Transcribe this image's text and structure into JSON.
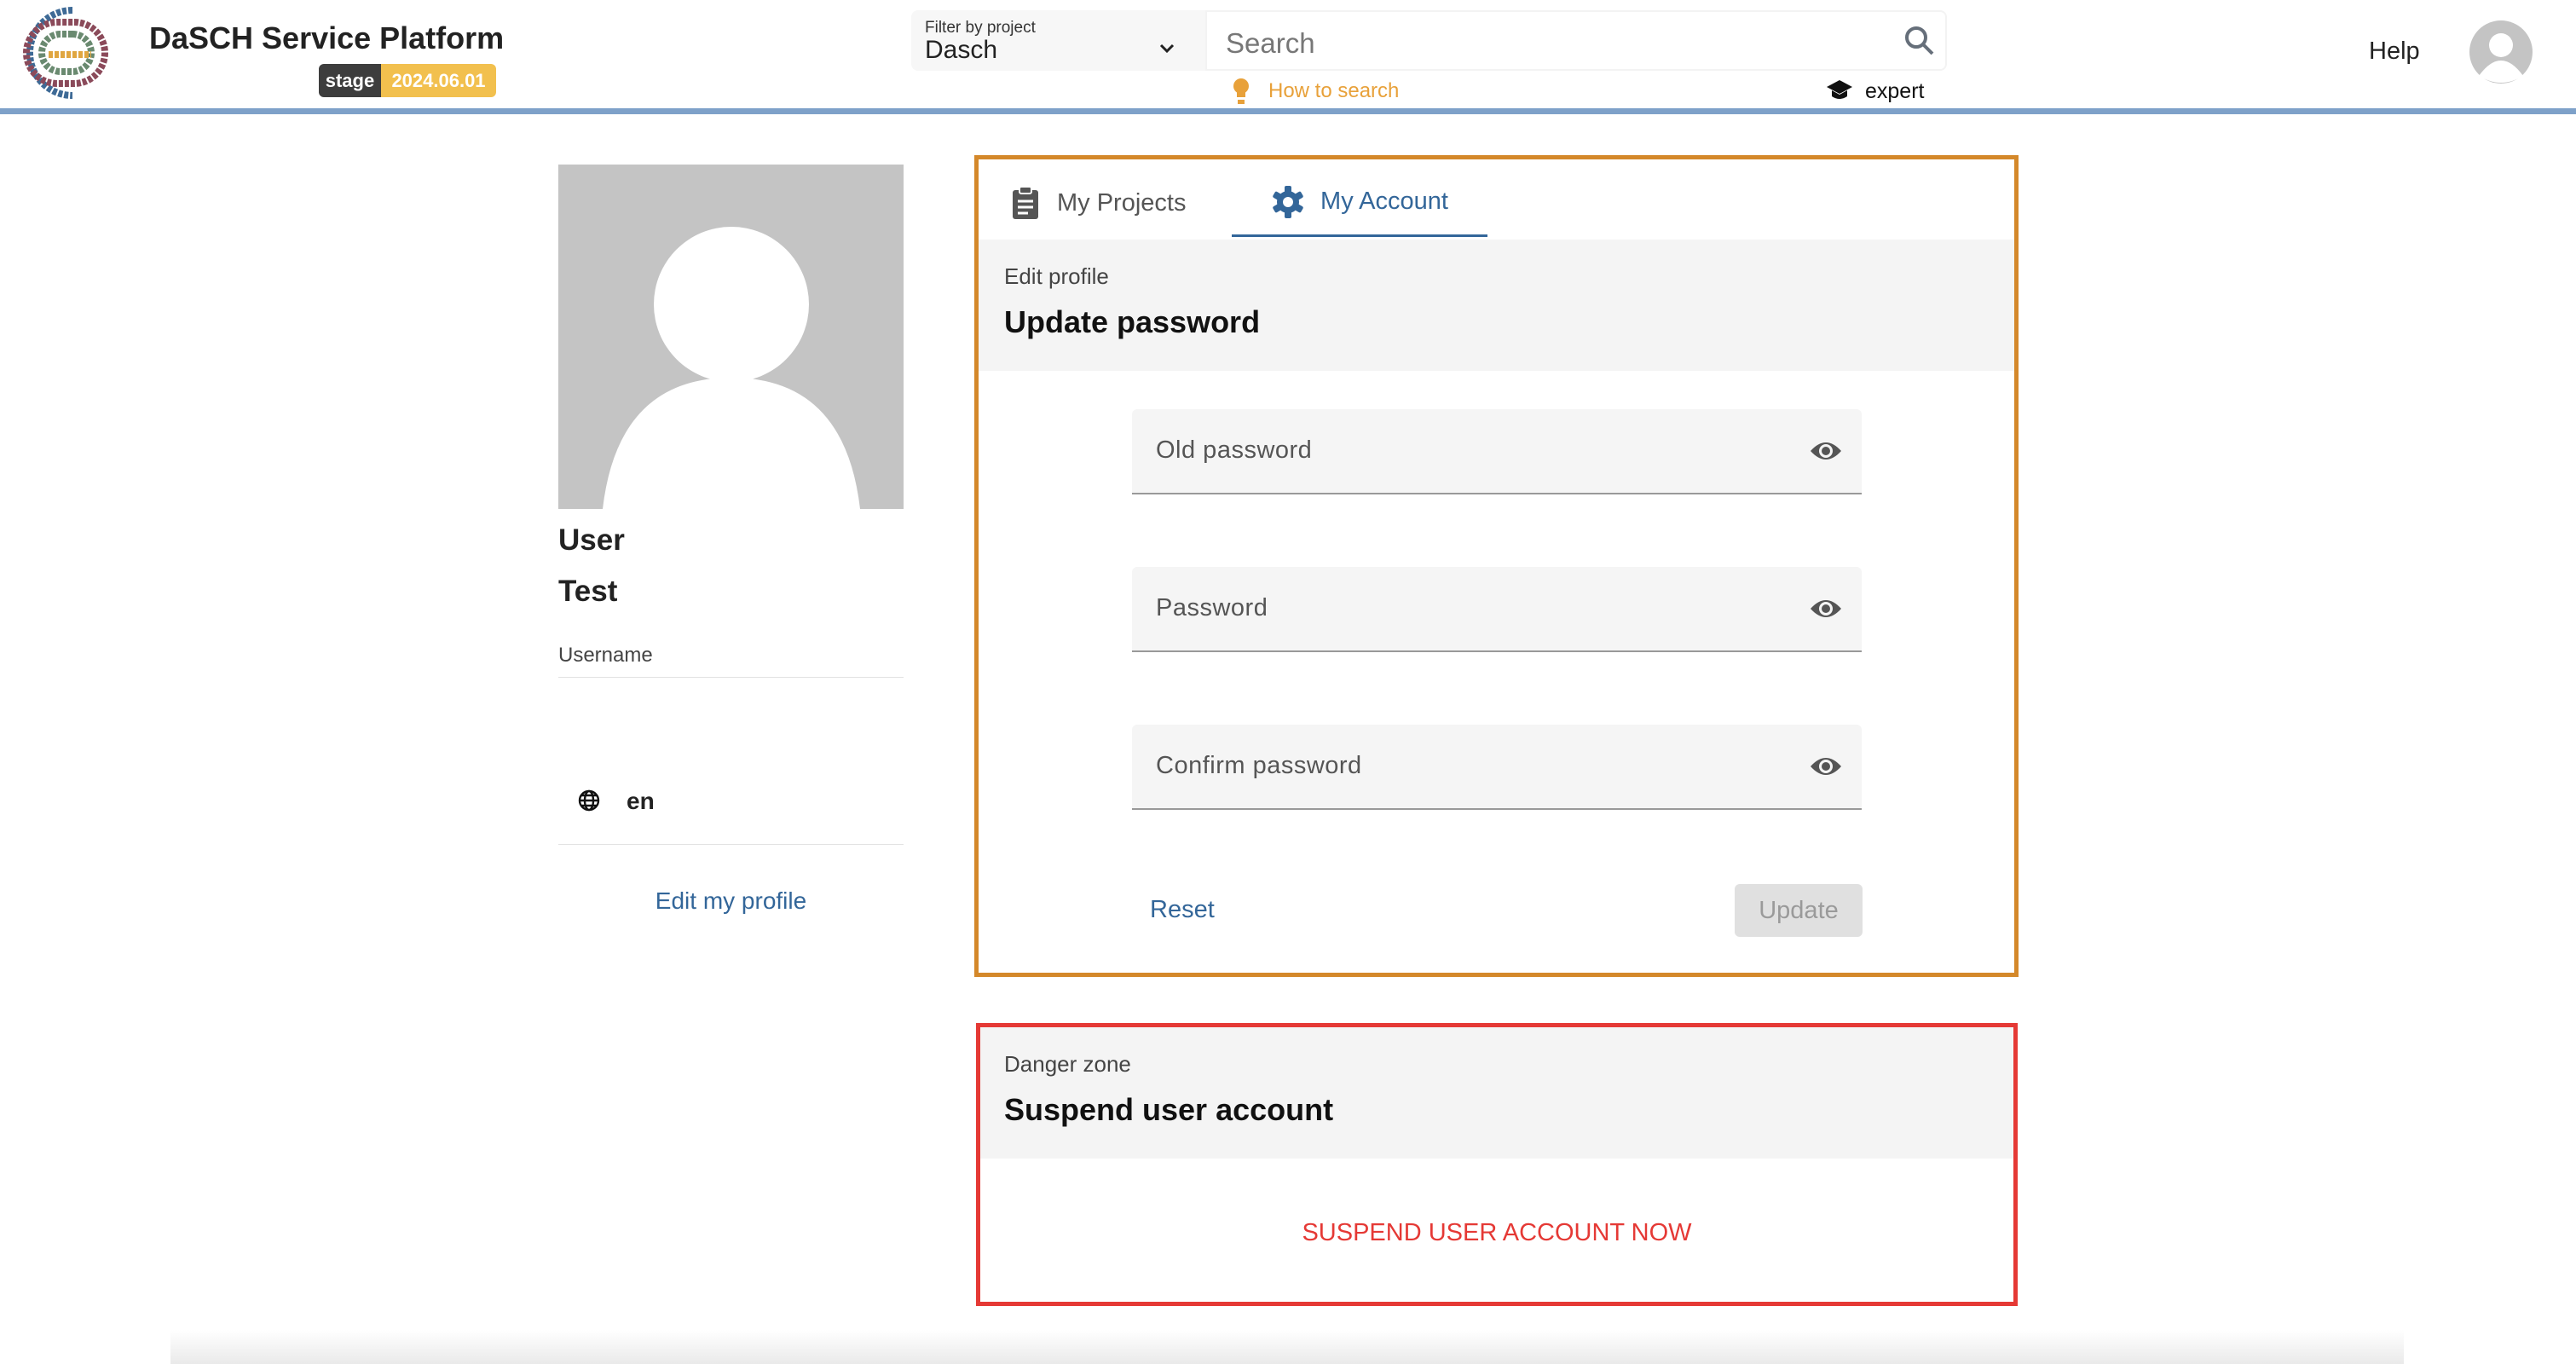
{
  "header": {
    "title": "DaSCH Service Platform",
    "env_badge": "stage",
    "version_badge": "2024.06.01",
    "filter": {
      "label": "Filter by project",
      "value": "Dasch"
    },
    "search": {
      "placeholder": "Search",
      "how_to": "How to search",
      "expert": "expert"
    },
    "help": "Help"
  },
  "profile": {
    "first_name": "User",
    "last_name": "Test",
    "username_label": "Username",
    "language": "en",
    "edit_link": "Edit my profile"
  },
  "tabs": [
    {
      "label": "My Projects",
      "icon": "clipboard-icon",
      "active": false
    },
    {
      "label": "My Account",
      "icon": "gear-icon",
      "active": true
    }
  ],
  "password": {
    "section": "Edit profile",
    "title": "Update password",
    "fields": [
      {
        "label": "Old password",
        "value": ""
      },
      {
        "label": "Password",
        "value": ""
      },
      {
        "label": "Confirm password",
        "value": ""
      }
    ],
    "reset": "Reset",
    "update": "Update"
  },
  "danger": {
    "section": "Danger zone",
    "title": "Suspend user account",
    "action": "SUSPEND USER ACCOUNT NOW"
  },
  "colors": {
    "accent": "#336699",
    "orange_border": "#d4882a",
    "danger": "#e53935",
    "header_bar": "#7ea1c9",
    "badge_version": "#f2c04e"
  }
}
